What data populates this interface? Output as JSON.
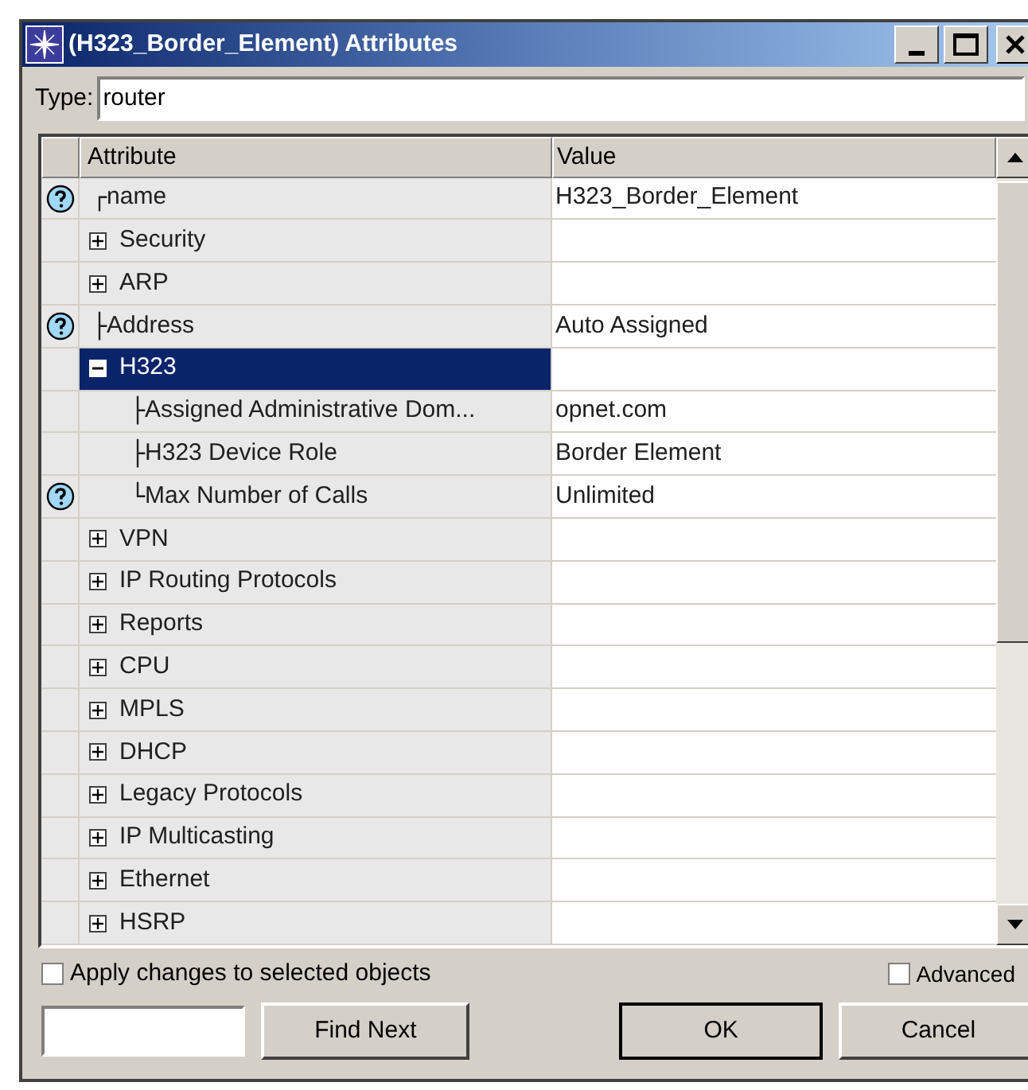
{
  "window": {
    "title": "(H323_Border_Element) Attributes"
  },
  "type_field": {
    "label": "Type:",
    "value": "router"
  },
  "table": {
    "columns": [
      "Attribute",
      "Value"
    ],
    "rows": [
      {
        "kind": "leaf",
        "connector": "┌",
        "label": "name",
        "value": "H323_Border_Element",
        "help": true,
        "selected": false
      },
      {
        "kind": "group",
        "label": "Security",
        "expanded": false,
        "help": false,
        "selected": false
      },
      {
        "kind": "group",
        "label": "ARP",
        "expanded": false,
        "help": false,
        "selected": false
      },
      {
        "kind": "leaf",
        "connector": "├",
        "label": "Address",
        "value": "Auto Assigned",
        "help": true,
        "selected": false
      },
      {
        "kind": "group",
        "label": "H323",
        "expanded": true,
        "help": false,
        "selected": true,
        "children": [
          {
            "kind": "leaf",
            "connector": "├",
            "label": "Assigned Administrative Dom...",
            "value": "opnet.com",
            "help": false,
            "selected": false
          },
          {
            "kind": "leaf",
            "connector": "├",
            "label": "H323 Device Role",
            "value": "Border Element",
            "help": false,
            "selected": false
          },
          {
            "kind": "leaf",
            "connector": "└",
            "label": "Max Number of Calls",
            "value": "Unlimited",
            "help": true,
            "selected": false
          }
        ]
      },
      {
        "kind": "group",
        "label": "VPN",
        "expanded": false,
        "help": false,
        "selected": false
      },
      {
        "kind": "group",
        "label": "IP Routing Protocols",
        "expanded": false,
        "help": false,
        "selected": false
      },
      {
        "kind": "group",
        "label": "Reports",
        "expanded": false,
        "help": false,
        "selected": false
      },
      {
        "kind": "group",
        "label": "CPU",
        "expanded": false,
        "help": false,
        "selected": false
      },
      {
        "kind": "group",
        "label": "MPLS",
        "expanded": false,
        "help": false,
        "selected": false
      },
      {
        "kind": "group",
        "label": "DHCP",
        "expanded": false,
        "help": false,
        "selected": false
      },
      {
        "kind": "group",
        "label": "Legacy Protocols",
        "expanded": false,
        "help": false,
        "selected": false
      },
      {
        "kind": "group",
        "label": "IP Multicasting",
        "expanded": false,
        "help": false,
        "selected": false
      },
      {
        "kind": "group",
        "label": "Ethernet",
        "expanded": false,
        "help": false,
        "selected": false
      },
      {
        "kind": "group",
        "label": "HSRP",
        "expanded": false,
        "help": false,
        "selected": false
      }
    ]
  },
  "apply_checkbox": {
    "label": "Apply changes to selected objects",
    "checked": false
  },
  "advanced_checkbox": {
    "label": "Advanced",
    "checked": false
  },
  "buttons": [
    "Find Next",
    "OK",
    "Cancel"
  ]
}
